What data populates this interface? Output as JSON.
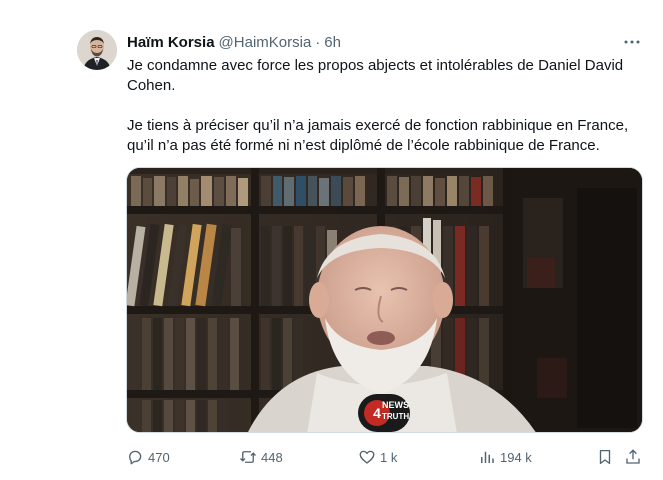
{
  "tweet": {
    "display_name": "Haïm Korsia",
    "handle": "@HaimKorsia",
    "dot": "·",
    "time": "6h",
    "paragraphs": [
      "Je condamne avec force les propos abjects et intolérables de Daniel David Cohen.",
      "Je tiens à préciser qu’il n’a jamais exercé de fonction rabbinique en France, qu’il n’a pas été formé ni n’est diplômé de l’école rabbinique de France."
    ],
    "media": {
      "watermark_number": "4",
      "watermark_line1": "NEWS",
      "watermark_line2": "TRUTH"
    },
    "actions": {
      "replies": "470",
      "reposts": "448",
      "likes": "1 k",
      "views": "194 k"
    },
    "icons": {
      "more": "more-icon",
      "reply": "reply-icon",
      "repost": "repost-icon",
      "like": "like-icon",
      "views": "views-icon",
      "bookmark": "bookmark-icon",
      "share": "share-icon"
    },
    "colors": {
      "text": "#0f1419",
      "secondary": "#536471",
      "border": "#cfd9de"
    }
  }
}
